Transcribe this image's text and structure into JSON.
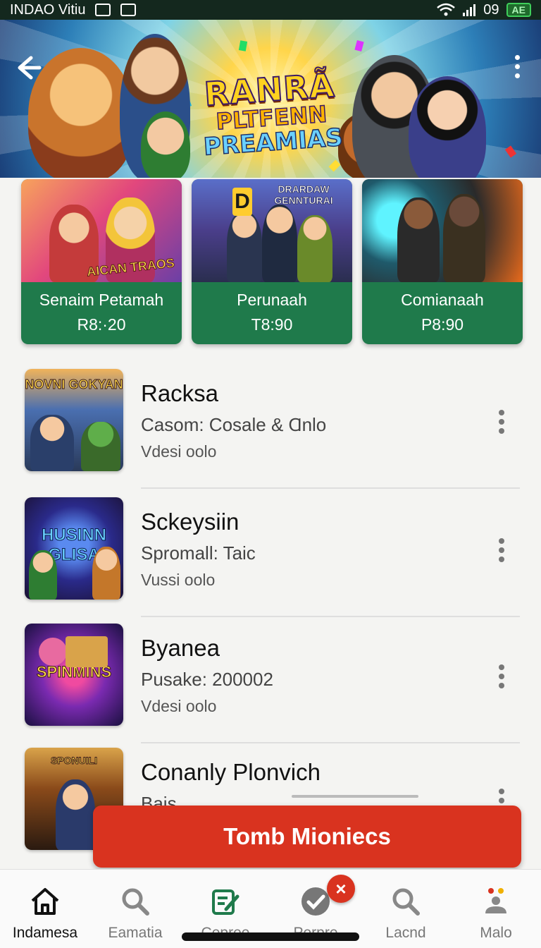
{
  "status_bar": {
    "carrier": "INDAO Vitiu",
    "clock": "0",
    "signal_text": "9",
    "battery": "AE"
  },
  "hero": {
    "title_line1": "RANRÃ",
    "title_line2": "PLTFENN",
    "title_line3": "PREAMIAS"
  },
  "featured": [
    {
      "title": "Senaim Petamah",
      "price": "R8:·20",
      "art_text": "AICAN TRAOS"
    },
    {
      "title": "Perunaah",
      "price": "T8:90",
      "art_badge": "D",
      "art_text": "DRARDAW GENNTURAI"
    },
    {
      "title": "Comianaah",
      "price": "P8:90"
    }
  ],
  "list": [
    {
      "title": "Racksa",
      "subtitle": "Casom: Cosale & Ɑnlo",
      "meta": "Vdesi oolo",
      "art_text": "NOVNI GOKYAN"
    },
    {
      "title": "Sckeysiin",
      "subtitle": "Spromall: Taic",
      "meta": "Vussi oolo",
      "art_text": "HUSINN GLISA"
    },
    {
      "title": "Byanea",
      "subtitle": "Pusake: 200002",
      "meta": "Vdesi oolo",
      "art_text": "SPINMINS"
    },
    {
      "title": "Conanly Plonvich",
      "subtitle": "Bais",
      "meta": "",
      "art_text": "SPONUILI"
    }
  ],
  "cta": {
    "label": "Tomb Mioniecs"
  },
  "notification": {
    "symbol": "×"
  },
  "bottom_nav": [
    {
      "label": "Indamesa",
      "icon": "home-icon"
    },
    {
      "label": "Eamatia",
      "icon": "search-icon"
    },
    {
      "label": "Cepree",
      "icon": "edit-icon"
    },
    {
      "label": "Perpre",
      "icon": "check-icon"
    },
    {
      "label": "Lacnd",
      "icon": "search-icon"
    },
    {
      "label": "Malo",
      "icon": "profile-icon"
    }
  ],
  "colors": {
    "accent_green": "#1f7a4b",
    "cta_red": "#d9331f"
  }
}
